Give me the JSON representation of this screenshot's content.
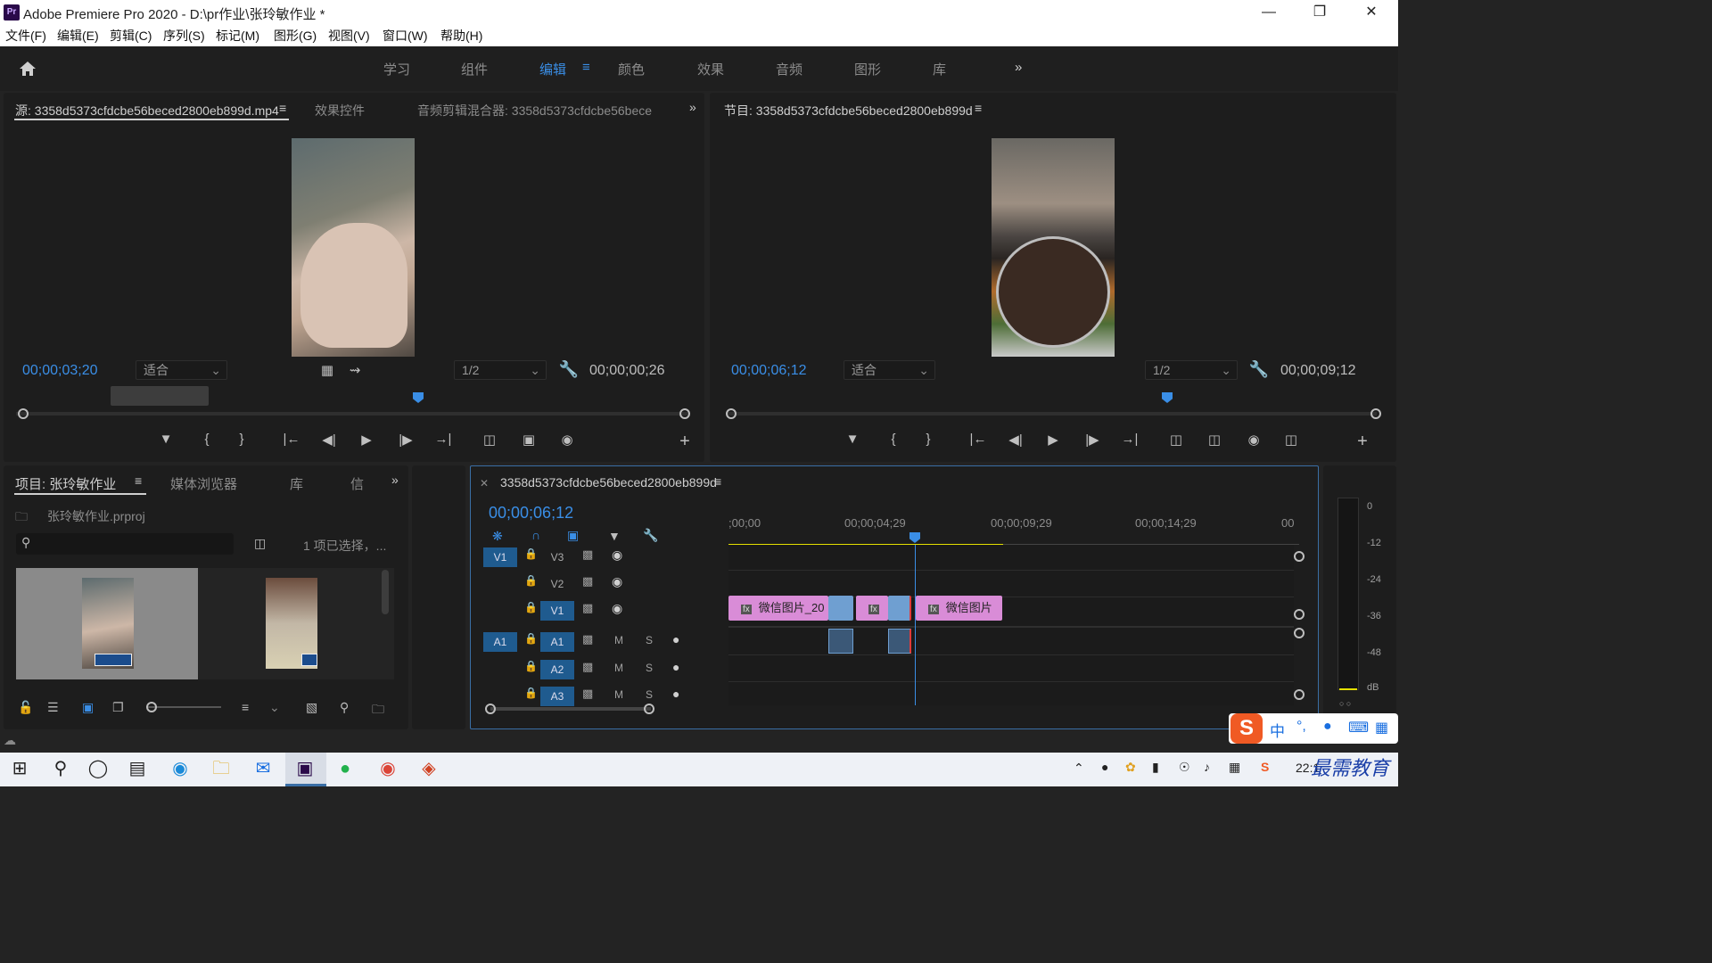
{
  "app": {
    "title": "Adobe Premiere Pro 2020 - D:\\pr作业\\张玲敏作业 *",
    "logo": "Pr"
  },
  "menu": [
    "文件(F)",
    "编辑(E)",
    "剪辑(C)",
    "序列(S)",
    "标记(M)",
    "图形(G)",
    "视图(V)",
    "窗口(W)",
    "帮助(H)"
  ],
  "workspaces": [
    "学习",
    "组件",
    "编辑",
    "颜色",
    "效果",
    "音频",
    "图形",
    "库"
  ],
  "workspace_active": "编辑",
  "source": {
    "tabs": [
      "源: 3358d5373cfdcbe56beced2800eb899d.mp4",
      "效果控件",
      "音频剪辑混合器: 3358d5373cfdcbe56bece"
    ],
    "timecode": "00;00;03;20",
    "fit": "适合",
    "resolution": "1/2",
    "duration": "00;00;00;26"
  },
  "program": {
    "tab": "节目: 3358d5373cfdcbe56beced2800eb899d",
    "timecode": "00;00;06;12",
    "fit": "适合",
    "resolution": "1/2",
    "duration": "00;00;09;12"
  },
  "project": {
    "tabs": [
      "项目: 张玲敏作业",
      "媒体浏览器",
      "库",
      "信"
    ],
    "file": "张玲敏作业.prproj",
    "selection": "1 项已选择，..."
  },
  "timeline": {
    "tab": "3358d5373cfdcbe56beced2800eb899d",
    "timecode": "00;00;06;12",
    "ruler": [
      ";00;00",
      "00;00;04;29",
      "00;00;09;29",
      "00;00;14;29",
      "00"
    ],
    "video_tracks": [
      {
        "target": "V1",
        "name": "V3"
      },
      {
        "target": "",
        "name": "V2"
      },
      {
        "target": "",
        "name": "V1"
      }
    ],
    "audio_tracks": [
      {
        "target": "A1",
        "name": "A1"
      },
      {
        "target": "",
        "name": "A2"
      },
      {
        "target": "",
        "name": "A3"
      }
    ],
    "track_m": "M",
    "track_s": "S",
    "clips": [
      {
        "label": "微信图片_20",
        "fx": "fx"
      },
      {
        "label": "",
        "fx": "fx"
      },
      {
        "label": "微信图片",
        "fx": "fx"
      }
    ]
  },
  "meter": {
    "scale": [
      "0",
      "-12",
      "-24",
      "-36",
      "-48",
      "dB"
    ]
  },
  "ime": {
    "label": "中",
    "punct": "°,"
  },
  "watermark": "最需教育",
  "clock": "22:1",
  "colors": {
    "accent_blue": "#3a8ee6",
    "clip_pink": "#d98cd7",
    "clip_blue": "#6f9fd1",
    "playhead": "#3a8ee6",
    "work_area": "#e5e000"
  }
}
